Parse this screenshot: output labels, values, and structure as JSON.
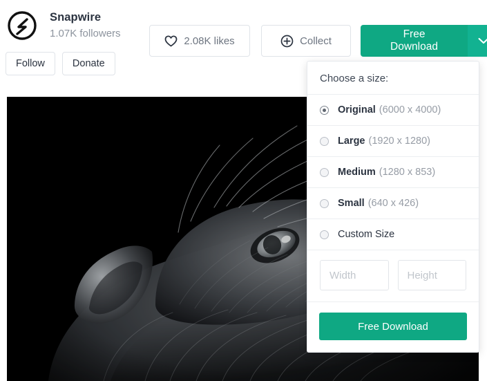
{
  "profile": {
    "logo_icon": "snapwire-circle-logo",
    "name": "Snapwire",
    "followers": "1.07K followers",
    "follow_label": "Follow",
    "donate_label": "Donate"
  },
  "actions": {
    "heart_icon": "heart-icon",
    "likes_label": "2.08K likes",
    "plus_icon": "plus-circle-icon",
    "collect_label": "Collect",
    "download_label": "Free Download",
    "caret_icon": "chevron-down-icon"
  },
  "size_panel": {
    "header": "Choose a size:",
    "options": [
      {
        "label": "Original",
        "dims": "(6000 x 4000)",
        "selected": true
      },
      {
        "label": "Large",
        "dims": "(1920 x 1280)",
        "selected": false
      },
      {
        "label": "Medium",
        "dims": "(1280 x 853)",
        "selected": false
      },
      {
        "label": "Small",
        "dims": "(640 x 426)",
        "selected": false
      },
      {
        "label": "Custom Size",
        "dims": "",
        "selected": false
      }
    ],
    "width_placeholder": "Width",
    "width_value": "",
    "height_placeholder": "Height",
    "height_value": "",
    "download_label": "Free Download"
  },
  "photo": {
    "alt": "black and white close-up photograph of a long-haired cat looking upward against a dark background"
  },
  "colors": {
    "accent_green": "#0fa883",
    "accent_green_light": "#12b291",
    "text_primary": "#2b3340",
    "text_muted": "#8d949e",
    "border": "#dfe3e8"
  }
}
